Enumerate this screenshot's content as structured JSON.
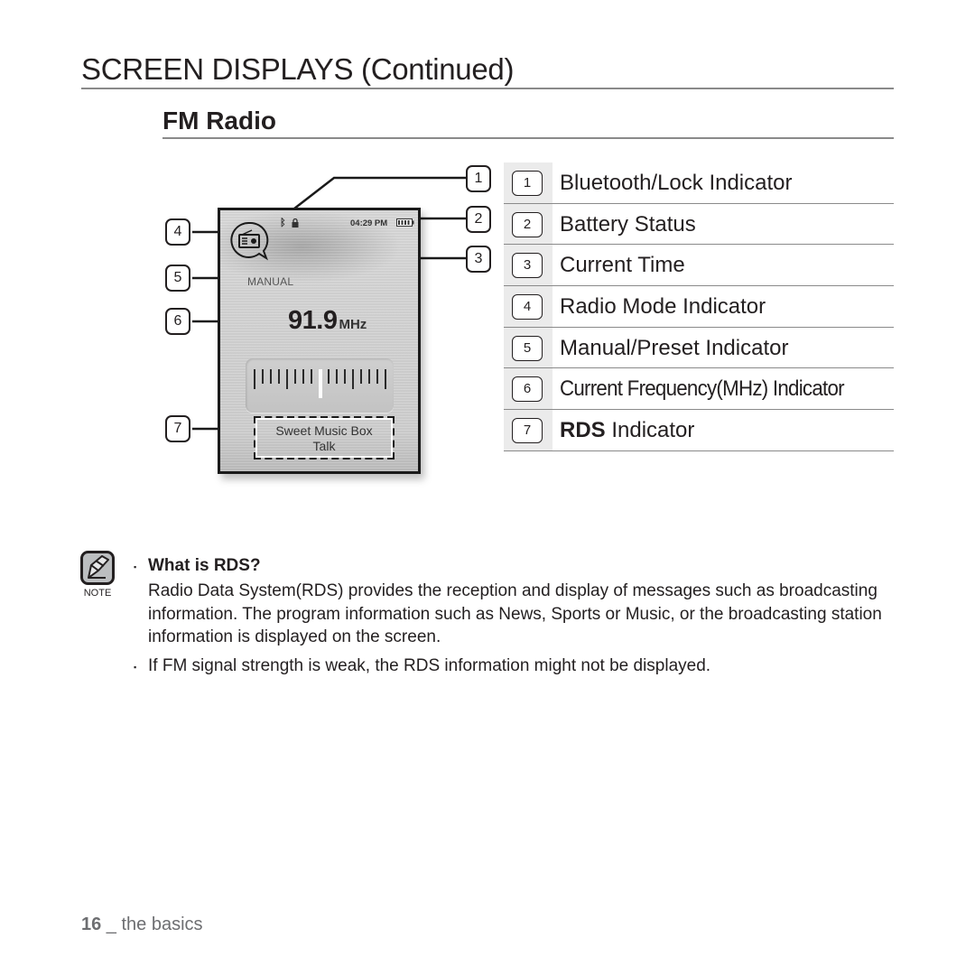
{
  "page": {
    "title": "SCREEN DISPLAYS (Continued)",
    "section_title": "FM Radio"
  },
  "device_screen": {
    "status_bar": {
      "bluetooth_icon": "bluetooth-icon",
      "lock_icon": "lock-icon",
      "time": "04:29 PM",
      "battery_icon": "battery-icon",
      "battery_level": "full"
    },
    "radio_mode_icon": "radio-icon",
    "mode_text": "MANUAL",
    "frequency_value": "91.9",
    "frequency_unit": "MHz",
    "tuner": {
      "ticks_left": 8,
      "ticks_right": 8,
      "needle": "center"
    },
    "rds": {
      "line1": "Sweet Music Box",
      "line2": "Talk"
    }
  },
  "callouts": [
    "1",
    "2",
    "3",
    "4",
    "5",
    "6",
    "7"
  ],
  "legend": [
    {
      "number": "1",
      "label": "Bluetooth/Lock Indicator"
    },
    {
      "number": "2",
      "label": "Battery Status"
    },
    {
      "number": "3",
      "label": "Current Time"
    },
    {
      "number": "4",
      "label": "Radio Mode Indicator"
    },
    {
      "number": "5",
      "label": "Manual/Preset Indicator"
    },
    {
      "number": "6",
      "label": "Current Frequency(MHz) Indicator"
    },
    {
      "number": "7",
      "label_bold": "RDS",
      "label_rest": " Indicator"
    }
  ],
  "note": {
    "icon": "note-pencil-icon",
    "icon_label": "NOTE",
    "bullet": "▪",
    "heading": "What is RDS?",
    "paragraph": "Radio Data System(RDS) provides the reception and display of messages such as broadcasting information. The program information such as News, Sports or Music, or the broadcasting station information is displayed on the screen.",
    "item2": "If FM signal strength is weak, the RDS information might not be displayed."
  },
  "footer": {
    "page_number": "16",
    "separator": " _ ",
    "section": "the basics"
  }
}
